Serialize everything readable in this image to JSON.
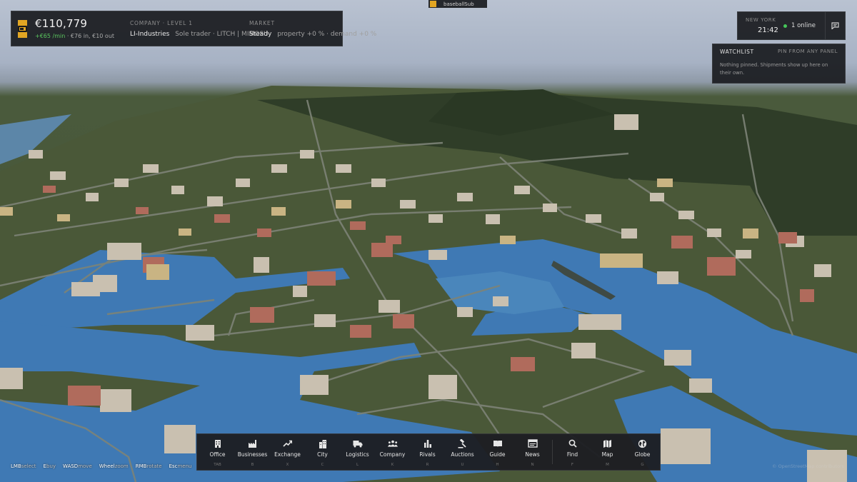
{
  "top_tag": {
    "text": "baseballSub"
  },
  "money": {
    "amount": "€110,779",
    "rate": "+€65 /min",
    "flow_detail": "· €76 in, €10 out"
  },
  "company": {
    "caption": "COMPANY · LEVEL 1",
    "name": "LI-Industries",
    "type": "Sole trader · LITCH | MIMOSU"
  },
  "market": {
    "caption": "MARKET",
    "state": "Steady",
    "detail": "property +0 % · demand +0 %"
  },
  "clock": {
    "city": "NEW YORK",
    "time": "21:42",
    "online": "1 online",
    "online_color": "#45c659"
  },
  "watchlist": {
    "title": "WATCHLIST",
    "pin_hint": "PIN FROM ANY PANEL",
    "empty_text": "Nothing pinned. Shipments show up here on their own."
  },
  "dock": {
    "items": [
      {
        "label": "Office",
        "key": "TAB",
        "icon": "office-icon"
      },
      {
        "label": "Businesses",
        "key": "B",
        "icon": "factory-icon"
      },
      {
        "label": "Exchange",
        "key": "X",
        "icon": "trend-icon"
      },
      {
        "label": "City",
        "key": "C",
        "icon": "city-icon"
      },
      {
        "label": "Logistics",
        "key": "L",
        "icon": "truck-icon"
      },
      {
        "label": "Company",
        "key": "K",
        "icon": "people-icon"
      },
      {
        "label": "Rivals",
        "key": "R",
        "icon": "bars-icon"
      },
      {
        "label": "Auctions",
        "key": "U",
        "icon": "gavel-icon"
      },
      {
        "label": "Guide",
        "key": "H",
        "icon": "book-icon"
      },
      {
        "label": "News",
        "key": "N",
        "icon": "news-icon"
      },
      {
        "label": "Find",
        "key": "F",
        "icon": "search-icon"
      },
      {
        "label": "Map",
        "key": "M",
        "icon": "map-icon"
      },
      {
        "label": "Globe",
        "key": "G",
        "icon": "globe-icon"
      }
    ]
  },
  "hints": [
    {
      "key": "LMB",
      "action": "select"
    },
    {
      "key": "E",
      "action": "buy"
    },
    {
      "key": "WASD",
      "action": "move"
    },
    {
      "key": "Wheel",
      "action": "zoom"
    },
    {
      "key": "RMB",
      "action": "rotate"
    },
    {
      "key": "Esc",
      "action": "menu"
    }
  ],
  "attribution": "© OpenStreetMap contributors"
}
